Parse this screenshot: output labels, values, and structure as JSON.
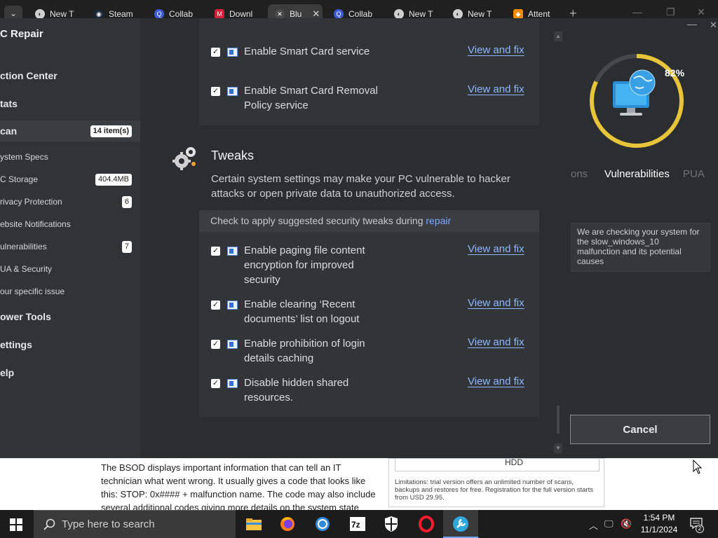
{
  "browser": {
    "tabs": [
      {
        "label": "New T"
      },
      {
        "label": "Steam"
      },
      {
        "label": "Collab"
      },
      {
        "label": "Downl"
      },
      {
        "label": "Blu"
      },
      {
        "label": "Collab"
      },
      {
        "label": "New T"
      },
      {
        "label": "New T"
      },
      {
        "label": "Attent"
      }
    ]
  },
  "app": {
    "brand": "C Repair",
    "nav": [
      {
        "label": "ction Center",
        "badge": ""
      },
      {
        "label": "tats",
        "badge": ""
      },
      {
        "label": "can",
        "badge": "14 item(s)"
      },
      {
        "label": "ystem Specs",
        "badge": ""
      },
      {
        "label": "C Storage",
        "badge": "404.4MB"
      },
      {
        "label": "rivacy Protection",
        "badge": "6"
      },
      {
        "label": "ebsite Notifications",
        "badge": ""
      },
      {
        "label": "ulnerabilities",
        "badge": "7"
      },
      {
        "label": "UA & Security",
        "badge": ""
      },
      {
        "label": "our specific issue",
        "badge": ""
      },
      {
        "label": "ower Tools",
        "badge": ""
      },
      {
        "label": "ettings",
        "badge": ""
      },
      {
        "label": "elp",
        "badge": ""
      }
    ],
    "top_items": [
      {
        "text": "Enable Smart Card service",
        "link": "View and fix"
      },
      {
        "text": "Enable Smart Card Removal Policy service",
        "link": "View and fix"
      }
    ],
    "tweaks": {
      "title": "Tweaks",
      "description": "Certain system settings may make your PC vulnerable to hacker attacks or open private data to unauthorized access.",
      "header_prefix": "Check to apply suggested security tweaks during",
      "header_link": "repair",
      "items": [
        {
          "text": "Enable paging file content encryption for improved security",
          "link": "View and fix"
        },
        {
          "text": "Enable clearing ‘Recent documents’ list on logout",
          "link": "View and fix"
        },
        {
          "text": "Enable prohibition of login details caching",
          "link": "View and fix"
        },
        {
          "text": "Disable hidden shared resources.",
          "link": "View and fix"
        }
      ]
    },
    "progress": {
      "percent_label": "82%",
      "value": 0.82
    },
    "scan_tabs": {
      "prev": "ons",
      "current": "Vulnerabilities",
      "next": "PUA"
    },
    "info_text": "We are checking your system for the slow_windows_10 malfunction and its potential causes",
    "cancel_label": "Cancel"
  },
  "webpage": {
    "paragraph": "The BSOD displays important information that can tell an IT technician what went wrong. It usually gives a code that looks like this: STOP: 0x#### + malfunction name. The code may also include several additional codes giving more details on the system state and",
    "hdd": "HDD",
    "limitations": "Limitations: trial version offers an unlimited number of scans, backups and restores for free. Registration for the full version starts from USD 29.95."
  },
  "taskbar": {
    "search_placeholder": "Type here to search",
    "time": "1:54 PM",
    "date": "11/1/2024",
    "notification_count": "2"
  }
}
